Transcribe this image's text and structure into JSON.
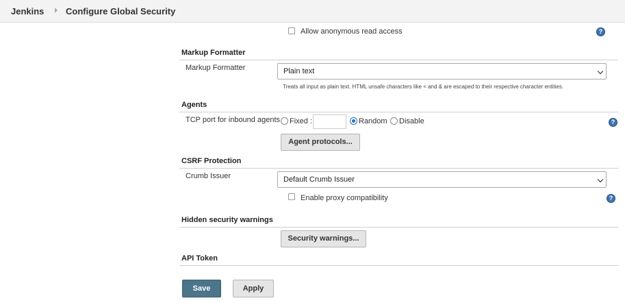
{
  "breadcrumb": {
    "home": "Jenkins",
    "page": "Configure Global Security"
  },
  "anonymous": {
    "label": "Allow anonymous read access",
    "checked": false
  },
  "markup": {
    "section_title": "Markup Formatter",
    "row_label": "Markup Formatter",
    "selected": "Plain text",
    "hint": "Treats all input as plain text. HTML unsafe characters like < and & are escaped to their respective character entities."
  },
  "agents": {
    "section_title": "Agents",
    "row_label": "TCP port for inbound agents",
    "fixed_label": "Fixed :",
    "random_label": "Random",
    "disable_label": "Disable",
    "selected": "Random",
    "port_value": "",
    "protocols_button": "Agent protocols..."
  },
  "csrf": {
    "section_title": "CSRF Protection",
    "row_label": "Crumb Issuer",
    "selected": "Default Crumb Issuer",
    "proxy_label": "Enable proxy compatibility",
    "proxy_checked": false
  },
  "warnings": {
    "section_title": "Hidden security warnings",
    "button": "Security warnings..."
  },
  "api_token": {
    "section_title": "API Token"
  },
  "footer": {
    "save": "Save",
    "apply": "Apply"
  },
  "icons": {
    "help": "help-icon",
    "help_glyph": "?"
  },
  "colors": {
    "save_bg": "#4b758b",
    "radio_accent": "#1a6fd1",
    "help_bg": "#3c74b5"
  }
}
